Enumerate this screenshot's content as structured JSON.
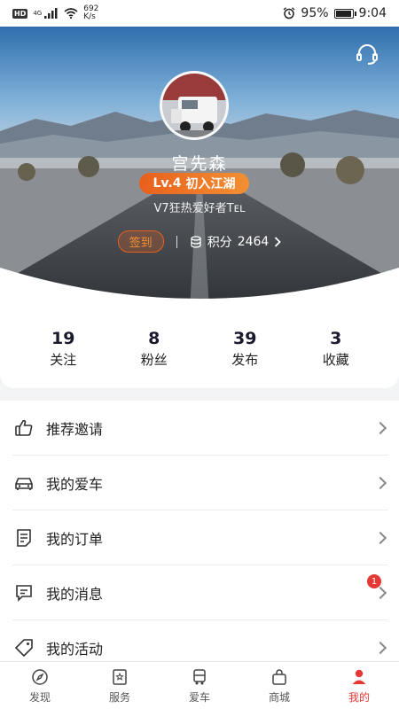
{
  "status_bar": {
    "hd_label": "HD",
    "network": "4G",
    "speed_value": "692",
    "speed_unit": "K/s",
    "battery": "95%",
    "time": "9:04"
  },
  "profile": {
    "username": "宫先森",
    "level": "Lv.4",
    "level_title": "初入江湖",
    "tag": "V7狂热爱好者Tᴇʟ",
    "checkin_label": "签到",
    "points_label": "积分",
    "points_value": "2464"
  },
  "stats": [
    {
      "count": "19",
      "label": "关注"
    },
    {
      "count": "8",
      "label": "粉丝"
    },
    {
      "count": "39",
      "label": "发布"
    },
    {
      "count": "3",
      "label": "收藏"
    }
  ],
  "menu": [
    {
      "label": "推荐邀请",
      "icon": "thumbs-up-icon"
    },
    {
      "label": "我的爱车",
      "icon": "car-icon"
    },
    {
      "label": "我的订单",
      "icon": "order-icon"
    },
    {
      "label": "我的消息",
      "icon": "message-icon",
      "badge": "1"
    },
    {
      "label": "我的活动",
      "icon": "tag-icon"
    }
  ],
  "bottom_nav": [
    {
      "label": "发现",
      "icon": "compass-icon"
    },
    {
      "label": "服务",
      "icon": "service-icon"
    },
    {
      "label": "爱车",
      "icon": "truck-icon"
    },
    {
      "label": "商城",
      "icon": "shopping-bag-icon"
    },
    {
      "label": "我的",
      "icon": "user-icon",
      "active": true
    }
  ],
  "colors": {
    "accent": "#e8601c",
    "badge_red": "#e53935",
    "active_tab": "#e53935"
  },
  "battery_level": 0.95
}
